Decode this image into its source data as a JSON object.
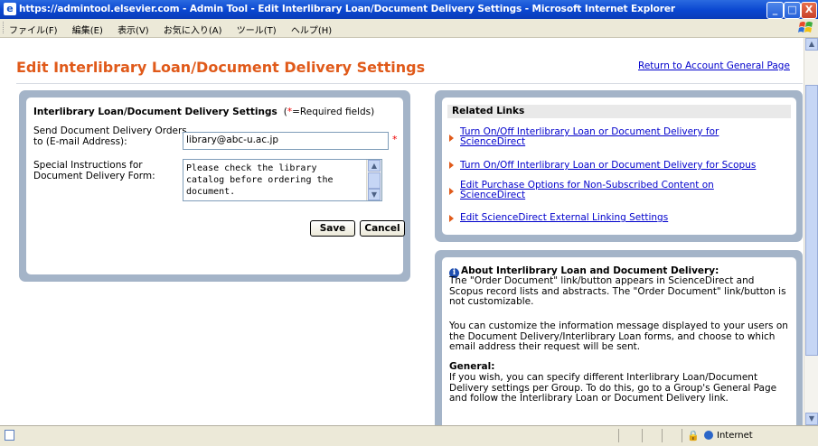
{
  "window": {
    "title": "https://admintool.elsevier.com - Admin Tool - Edit Interlibrary Loan/Document Delivery Settings - Microsoft Internet Explorer",
    "minimize": "_",
    "maximize": "□",
    "close": "X"
  },
  "menu": {
    "items": [
      "ファイル(F)",
      "編集(E)",
      "表示(V)",
      "お気に入り(A)",
      "ツール(T)",
      "ヘルプ(H)"
    ]
  },
  "page": {
    "title": "Edit Interlibrary Loan/Document Delivery Settings",
    "return_link": "Return to Account General Page"
  },
  "settings_form": {
    "heading": "Interlibrary Loan/Document Delivery Settings",
    "required_note_open": "(",
    "required_star": "*",
    "required_note_close": "=Required fields)",
    "email_label": "Send Document Delivery Orders to (E-mail Address):",
    "email_value": "library@abc-u.ac.jp",
    "email_required": "*",
    "instructions_label": "Special Instructions for Document Delivery Form:",
    "instructions_value": "Please check the library catalog before ordering the document.",
    "save_label": "Save",
    "cancel_label": "Cancel"
  },
  "related_links": {
    "heading": "Related Links",
    "items": [
      "Turn On/Off Interlibrary Loan or Document Delivery for ScienceDirect",
      "Turn On/Off Interlibrary Loan or Document Delivery for Scopus",
      "Edit Purchase Options for Non-Subscribed Content on ScienceDirect",
      "Edit ScienceDirect External Linking Settings"
    ]
  },
  "about": {
    "title": "About Interlibrary Loan and Document Delivery:",
    "para1": "The \"Order Document\" link/button appears in ScienceDirect and Scopus record lists and abstracts.  The \"Order Document\" link/button is not customizable.",
    "para2": "You can customize the information message displayed to your users on the Document Delivery/Interlibrary Loan forms, and choose to which email address their request will be sent.",
    "general_heading": "General:",
    "para3": "If you wish, you can specify different Interlibrary Loan/Document Delivery settings per Group. To do this, go to a Group's General Page and follow the Interlibrary Loan or Document Delivery link."
  },
  "status": {
    "zone": "Internet"
  },
  "colors": {
    "title_orange": "#e05a1a",
    "link_blue": "#0000cc",
    "panel_bg": "#a4b4c8",
    "required_red": "#ee0000"
  }
}
